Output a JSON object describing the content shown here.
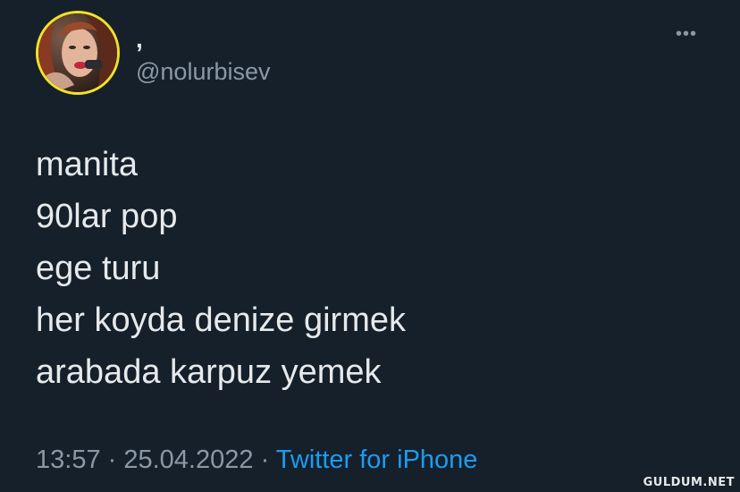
{
  "user": {
    "display_name": ",",
    "handle": "@nolurbisev",
    "avatar_icon": "profile-photo",
    "avatar_ring_color": "#f2e229"
  },
  "more_icon": "more-options-icon",
  "more_glyph": "•••",
  "tweet": {
    "lines": [
      "manita",
      "90lar pop",
      "ege turu",
      "her koyda denize girmek",
      "arabada karpuz yemek"
    ]
  },
  "meta": {
    "time": "13:57",
    "separator": " · ",
    "date": "25.04.2022",
    "source": "Twitter for iPhone"
  },
  "watermark": "GULDUM.NET",
  "colors": {
    "background": "#15202b",
    "text_primary": "#e7e9ea",
    "text_secondary": "#8b98a5",
    "link": "#1d9bf0"
  }
}
